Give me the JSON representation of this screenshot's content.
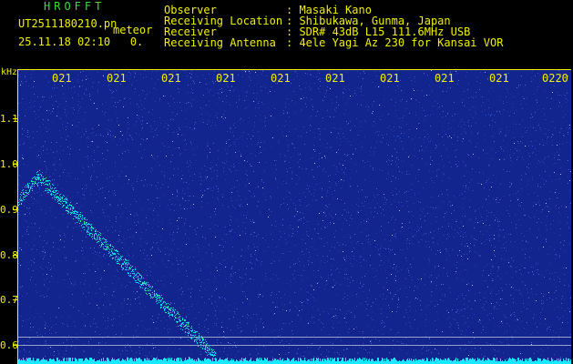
{
  "header": {
    "brand": "HROFFT",
    "filename": "UT2511180210.pn",
    "tag": "meteor",
    "timestamp": "25.11.18 02:10   0."
  },
  "meta": [
    {
      "key": "Observer",
      "value": ": Masaki Kano"
    },
    {
      "key": "Receiving Location",
      "value": ": Shibukawa, Gunma, Japan"
    },
    {
      "key": "Receiver",
      "value": ": SDR# 43dB L15 111.6MHz USB"
    },
    {
      "key": "Receiving Antenna",
      "value": ": 4ele Yagi Az 230 for Kansai VOR"
    }
  ],
  "axis": {
    "unit": "kHz",
    "yticks": [
      "1.1",
      "1.0",
      "0.9",
      "0.8",
      "0.7",
      "0.6"
    ],
    "xticks": [
      "021",
      "021",
      "021",
      "021",
      "021",
      "021",
      "021",
      "021",
      "021",
      "0220"
    ]
  },
  "colors": {
    "background": "#000000",
    "spectrogram": "#12248e",
    "label": "#f0f000",
    "brand": "#3cdc3c",
    "trace": "#00e8ff"
  }
}
